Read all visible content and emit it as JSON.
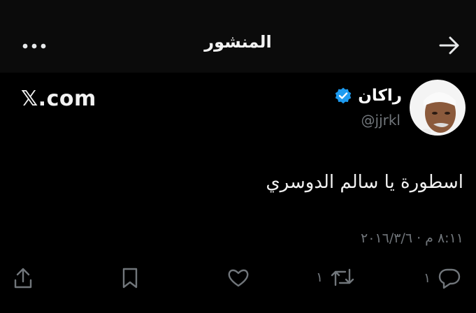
{
  "header": {
    "title": "المنشور"
  },
  "brand": "𝕏.com",
  "tweet": {
    "author_name": "راكان",
    "handle": "@jjrkl",
    "text": "اسطورة يا سالم الدوسري",
    "timestamp": "٨:١١ م · ٢٠١٦/٣/٦"
  },
  "actions": {
    "reply_count": "١",
    "retweet_count": "١"
  },
  "colors": {
    "background": "#000000",
    "header_bg": "#0b0b0b",
    "text": "#e7e9ea",
    "muted": "#71767b",
    "verified": "#1d9bf0"
  }
}
